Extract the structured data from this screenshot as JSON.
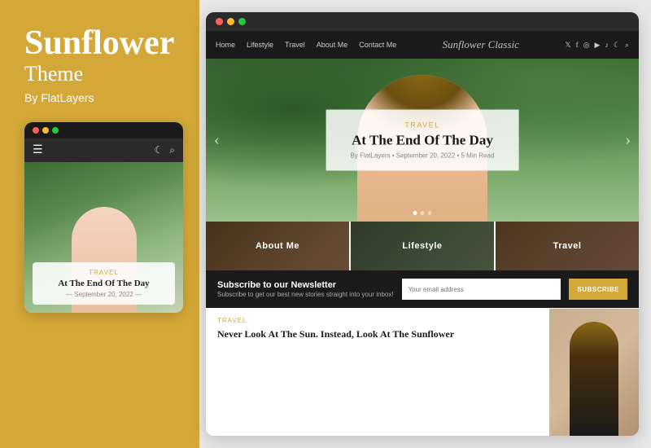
{
  "left": {
    "title": "Sunflower",
    "subtitle": "Theme",
    "by": "By FlatLayers"
  },
  "mobile": {
    "dots": [
      {
        "color": "#ff5f56"
      },
      {
        "color": "#ffbd2e"
      },
      {
        "color": "#27c93f"
      }
    ],
    "hero_tag": "Travel",
    "hero_title": "At The End Of The Day",
    "hero_date": "— September 20, 2022 —"
  },
  "desktop": {
    "dots": [
      {
        "color": "#ff5f56"
      },
      {
        "color": "#ffbd2e"
      },
      {
        "color": "#27c93f"
      }
    ],
    "nav": {
      "links": [
        "Home",
        "Lifestyle",
        "Travel",
        "About Me",
        "Contact Me"
      ],
      "brand": "Sunflower Classic",
      "icons": [
        "𝕏",
        "f",
        "☁",
        "▶",
        "♪",
        "☾",
        "🔍"
      ]
    },
    "hero": {
      "tag": "Travel",
      "title": "At The End Of The Day",
      "meta": "By FlatLayers • September 20, 2022 • 5 Min Read"
    },
    "categories": [
      {
        "label": "About Me"
      },
      {
        "label": "Lifestyle"
      },
      {
        "label": "Travel"
      }
    ],
    "newsletter": {
      "title": "Subscribe to our Newsletter",
      "subtitle": "Subscribe to get our best new stories straight into your inbox!",
      "placeholder": "Your email address",
      "button": "SUBSCRIBE"
    },
    "bottom_article": {
      "tag": "Travel",
      "title": "Never Look At The Sun. Instead, Look At The Sunflower"
    }
  }
}
